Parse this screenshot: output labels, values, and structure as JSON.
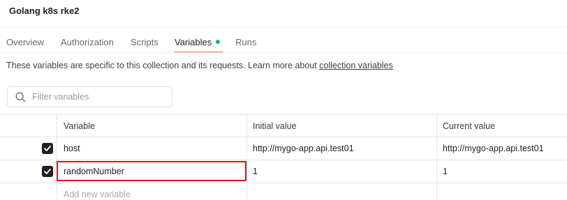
{
  "collection": {
    "title": "Golang k8s rke2"
  },
  "tabs": [
    {
      "label": "Overview"
    },
    {
      "label": "Authorization"
    },
    {
      "label": "Scripts"
    },
    {
      "label": "Variables",
      "active": true,
      "indicator_color": "#0cbb52"
    },
    {
      "label": "Runs"
    }
  ],
  "accent_color": "#ff6c37",
  "highlight_color": "#e0161e",
  "description": {
    "text": "These variables are specific to this collection and its requests. Learn more about ",
    "link": "collection variables"
  },
  "filter": {
    "placeholder": "Filter variables",
    "icon": "search-icon"
  },
  "table": {
    "columns": [
      "Variable",
      "Initial value",
      "Current value"
    ],
    "rows": [
      {
        "checked": true,
        "variable": "host",
        "initial_value": "http://mygo-app.api.test01",
        "current_value": "http://mygo-app.api.test01"
      },
      {
        "checked": true,
        "variable": "randomNumber",
        "initial_value": "1",
        "current_value": "1",
        "highlighted": true
      }
    ],
    "new_row_placeholder": "Add new variable"
  }
}
